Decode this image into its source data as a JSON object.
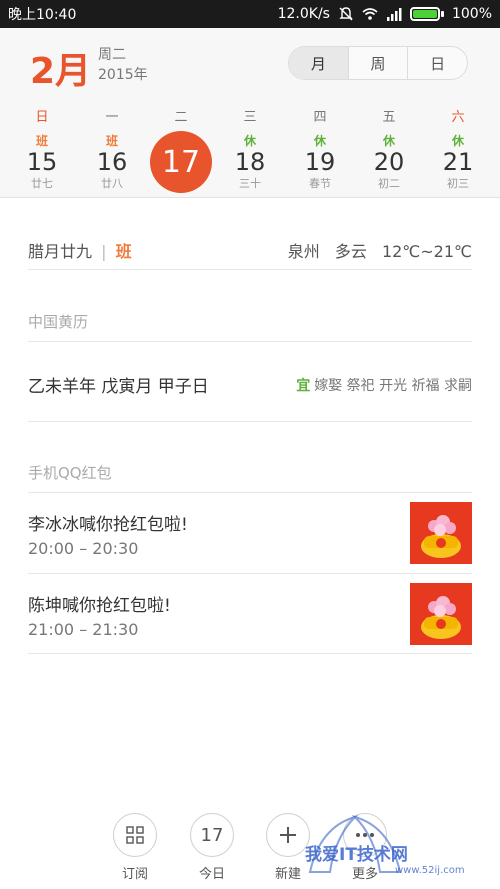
{
  "statusbar": {
    "time": "晚上10:40",
    "speed": "12.0K/s",
    "battery": "100%"
  },
  "header": {
    "month": "2月",
    "weekday": "周二",
    "year": "2015年",
    "view_tabs": [
      "月",
      "周",
      "日"
    ],
    "selected_view": "月"
  },
  "week": {
    "day_names": [
      "日",
      "一",
      "二",
      "三",
      "四",
      "五",
      "六"
    ],
    "days": [
      {
        "tag": "班",
        "num": "15",
        "lunar": "廿七"
      },
      {
        "tag": "班",
        "num": "16",
        "lunar": "廿八"
      },
      {
        "tag": "",
        "num": "17",
        "lunar": ""
      },
      {
        "tag": "休",
        "num": "18",
        "lunar": "三十"
      },
      {
        "tag": "休",
        "num": "19",
        "lunar": "春节"
      },
      {
        "tag": "休",
        "num": "20",
        "lunar": "初二"
      },
      {
        "tag": "休",
        "num": "21",
        "lunar": "初三"
      }
    ]
  },
  "info": {
    "lunar_date": "腊月廿九",
    "separator": "|",
    "work_tag": "班",
    "city": "泉州",
    "weather": "多云",
    "temp": "12℃~21℃"
  },
  "almanac": {
    "title": "中国黄历",
    "ganzhi": "乙未羊年 戊寅月 甲子日",
    "yi_label": "宜",
    "yi_items": "嫁娶 祭祀 开光 祈福 求嗣"
  },
  "events": {
    "section": "手机QQ红包",
    "items": [
      {
        "title": "李冰冰喊你抢红包啦!",
        "time": "20:00 – 20:30"
      },
      {
        "title": "陈坤喊你抢红包啦!",
        "time": "21:00 – 21:30"
      }
    ]
  },
  "toolbar": {
    "subscribe": "订阅",
    "today": "今日",
    "today_num": "17",
    "new": "新建",
    "more": "更多"
  },
  "watermark": {
    "main": "我爱IT技术网",
    "sub": "www.52ij.com"
  },
  "colors": {
    "accent": "#e8542b",
    "work": "#f07c3a",
    "rest": "#5fb13a",
    "hongbao_bg": "#e6391f"
  }
}
